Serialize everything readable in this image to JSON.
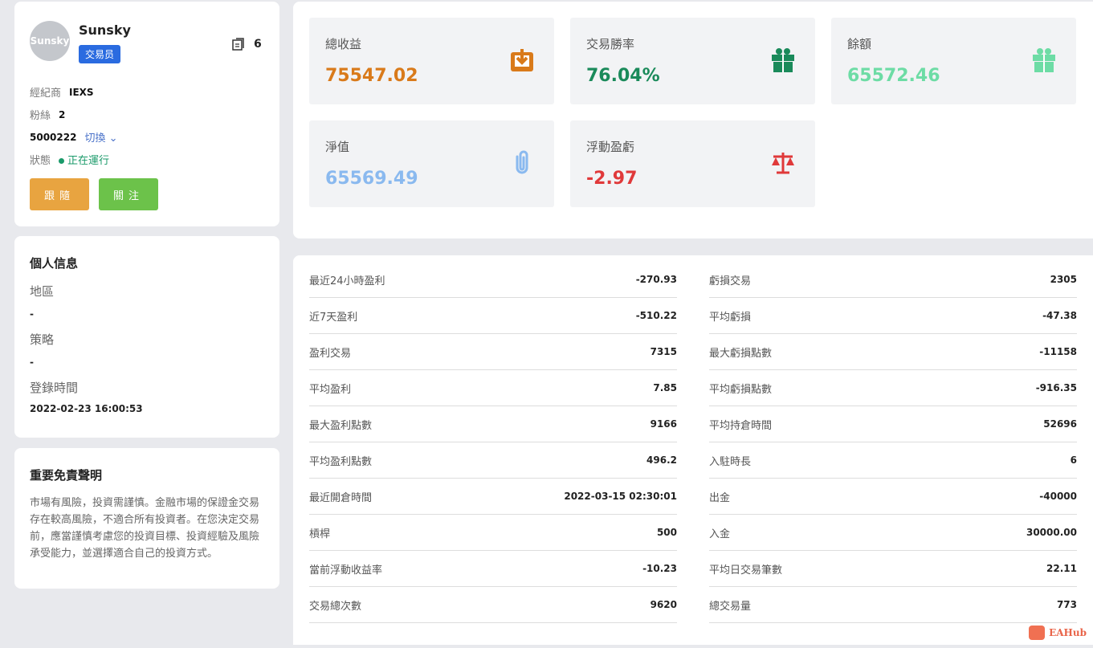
{
  "profile": {
    "avatar_text": "Sunsky",
    "name": "Sunsky",
    "badge": "交易员",
    "copy_count": "6",
    "broker_label": "經紀商",
    "broker": "IEXS",
    "fans_label": "粉絲",
    "fans": "2",
    "account": "5000222",
    "switch_label": "切換",
    "status_label": "狀態",
    "status": "正在運行",
    "follow_label": "跟隨",
    "watch_label": "關注",
    "status_color": "#1a9a6a"
  },
  "personal": {
    "title": "個人信息",
    "region_label": "地區",
    "region": "-",
    "strategy_label": "策略",
    "strategy": "-",
    "login_label": "登錄時間",
    "login": "2022-02-23 16:00:53"
  },
  "disclaimer": {
    "title": "重要免責聲明",
    "text": "市場有風險，投資需謹慎。金融市場的保證金交易存在較高風險，不適合所有投資者。在您決定交易前，應當謹慎考慮您的投資目標、投資經驗及風險承受能力，並選擇適合自己的投資方式。"
  },
  "tiles": [
    {
      "label": "總收益",
      "value": "75547.02",
      "color": "#d97a1a",
      "icon": "download-box-icon"
    },
    {
      "label": "交易勝率",
      "value": "76.04%",
      "color": "#1a8a5a",
      "icon": "gift-icon"
    },
    {
      "label": "餘額",
      "value": "65572.46",
      "color": "#6ddca5",
      "icon": "gift-icon"
    },
    {
      "label": "淨值",
      "value": "65569.49",
      "color": "#8ab9ef",
      "icon": "paperclip-icon"
    },
    {
      "label": "浮動盈虧",
      "value": "-2.97",
      "color": "#e0393a",
      "icon": "scale-icon"
    }
  ],
  "stats_left": [
    {
      "k": "最近24小時盈利",
      "v": "-270.93"
    },
    {
      "k": "近7天盈利",
      "v": "-510.22"
    },
    {
      "k": "盈利交易",
      "v": "7315"
    },
    {
      "k": "平均盈利",
      "v": "7.85"
    },
    {
      "k": "最大盈利點數",
      "v": "9166"
    },
    {
      "k": "平均盈利點數",
      "v": "496.2"
    },
    {
      "k": "最近開倉時間",
      "v": "2022-03-15 02:30:01"
    },
    {
      "k": "槓桿",
      "v": "500"
    },
    {
      "k": "當前浮動收益率",
      "v": "-10.23"
    },
    {
      "k": "交易總次數",
      "v": "9620"
    }
  ],
  "stats_right": [
    {
      "k": "虧損交易",
      "v": "2305"
    },
    {
      "k": "平均虧損",
      "v": "-47.38"
    },
    {
      "k": "最大虧損點數",
      "v": "-11158"
    },
    {
      "k": "平均虧損點數",
      "v": "-916.35"
    },
    {
      "k": "平均持倉時間",
      "v": "52696"
    },
    {
      "k": "入駐時長",
      "v": "6"
    },
    {
      "k": "出金",
      "v": "-40000"
    },
    {
      "k": "入金",
      "v": "30000.00"
    },
    {
      "k": "平均日交易筆數",
      "v": "22.11"
    },
    {
      "k": "總交易量",
      "v": "773"
    }
  ],
  "watermark": "EAHub"
}
